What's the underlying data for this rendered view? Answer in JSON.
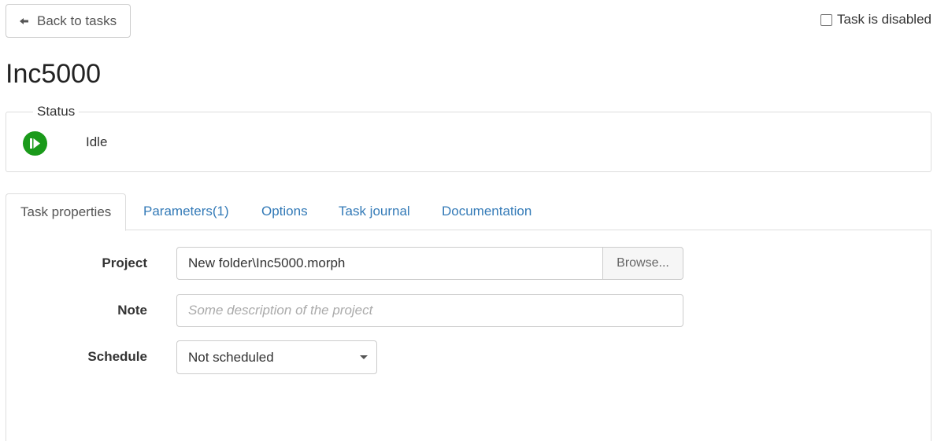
{
  "header": {
    "back_label": "Back to tasks",
    "back_icon": "arrow-left-icon",
    "disabled_label": "Task is disabled",
    "disabled_checked": false
  },
  "task": {
    "title": "Inc5000"
  },
  "status": {
    "legend": "Status",
    "text": "Idle",
    "icon": "play-circle-icon",
    "icon_color": "#1a9a1a"
  },
  "tabs": [
    {
      "label": "Task properties",
      "active": true
    },
    {
      "label": "Parameters(1)",
      "active": false
    },
    {
      "label": "Options",
      "active": false
    },
    {
      "label": "Task journal",
      "active": false
    },
    {
      "label": "Documentation",
      "active": false
    }
  ],
  "form": {
    "project_label": "Project",
    "project_value": "New folder\\Inc5000.morph",
    "browse_label": "Browse...",
    "note_label": "Note",
    "note_placeholder": "Some description of the project",
    "schedule_label": "Schedule",
    "schedule_value": "Not scheduled"
  },
  "colors": {
    "link": "#337ab7",
    "border": "#dddddd"
  }
}
